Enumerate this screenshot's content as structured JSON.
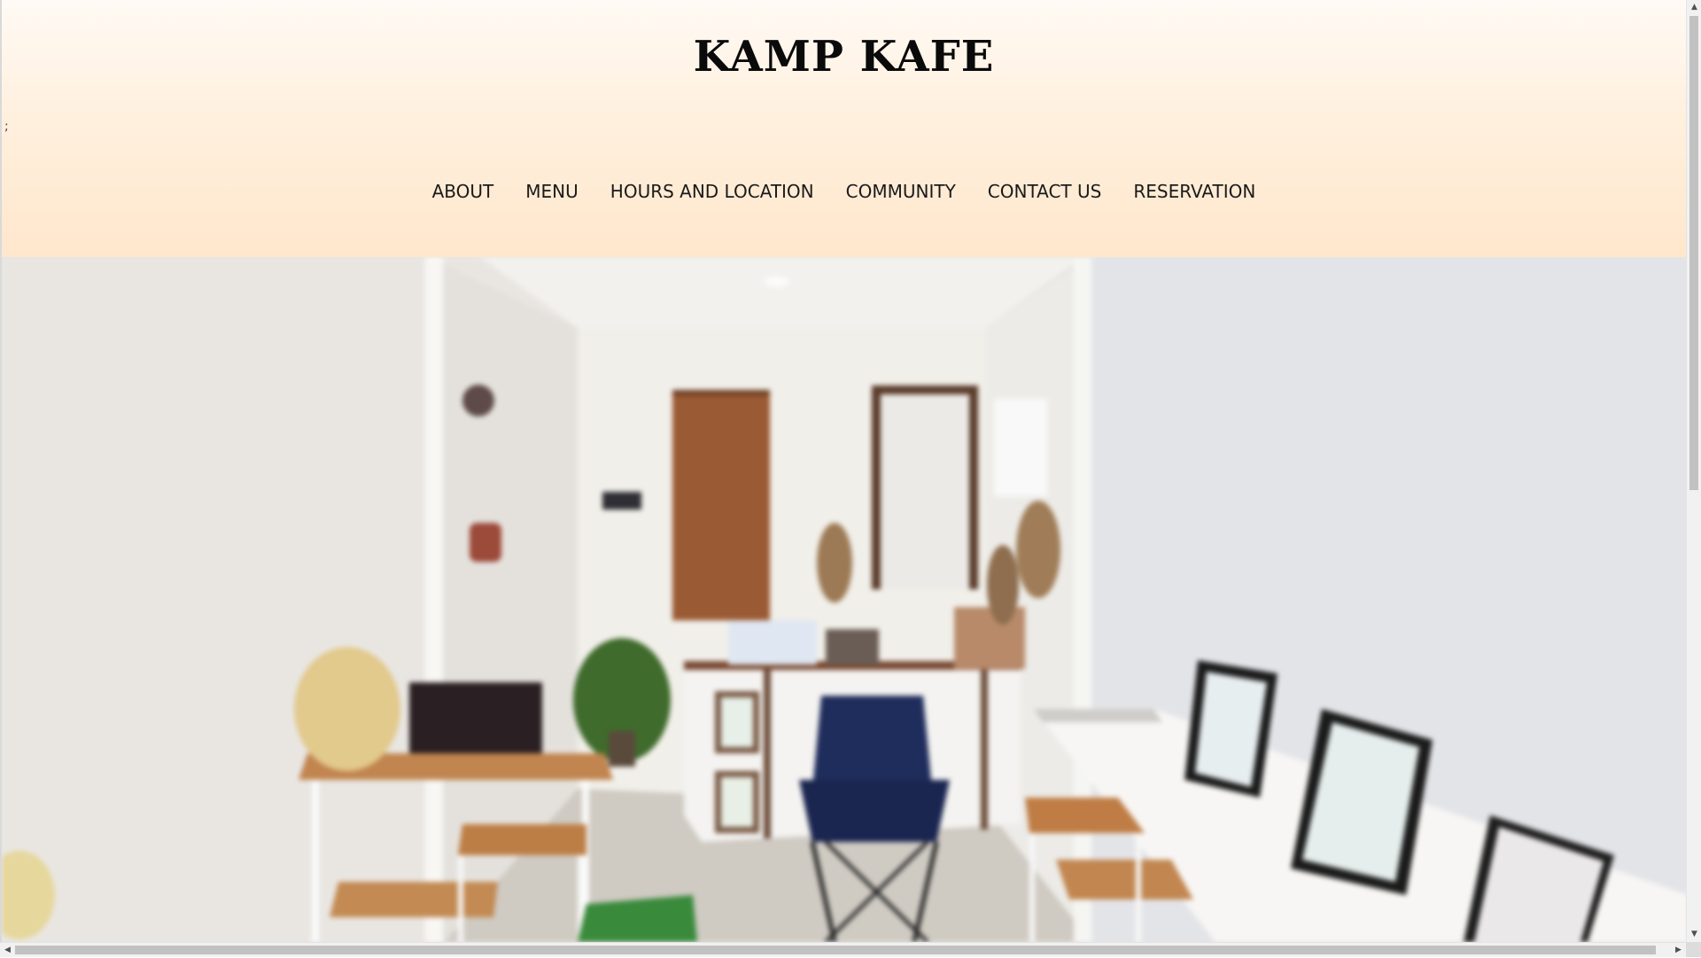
{
  "site": {
    "title": "KAMP KAFE",
    "stray_mark": ";"
  },
  "nav": {
    "items": [
      {
        "label": "ABOUT"
      },
      {
        "label": "MENU"
      },
      {
        "label": "HOURS AND LOCATION"
      },
      {
        "label": "COMMUNITY"
      },
      {
        "label": "CONTACT US"
      },
      {
        "label": "RESERVATION"
      }
    ]
  },
  "colors": {
    "header_top": "#fffaf5",
    "header_bottom": "#ffe7cc",
    "title": "#0a0a0a",
    "nav_text": "#1a1a1a",
    "wall": "#e8e6e3",
    "chair": "#1f2d5c",
    "wood": "#b8733f"
  },
  "icons": {
    "scroll_up": "▲",
    "scroll_down": "▼",
    "scroll_left": "◀",
    "scroll_right": "▶"
  }
}
